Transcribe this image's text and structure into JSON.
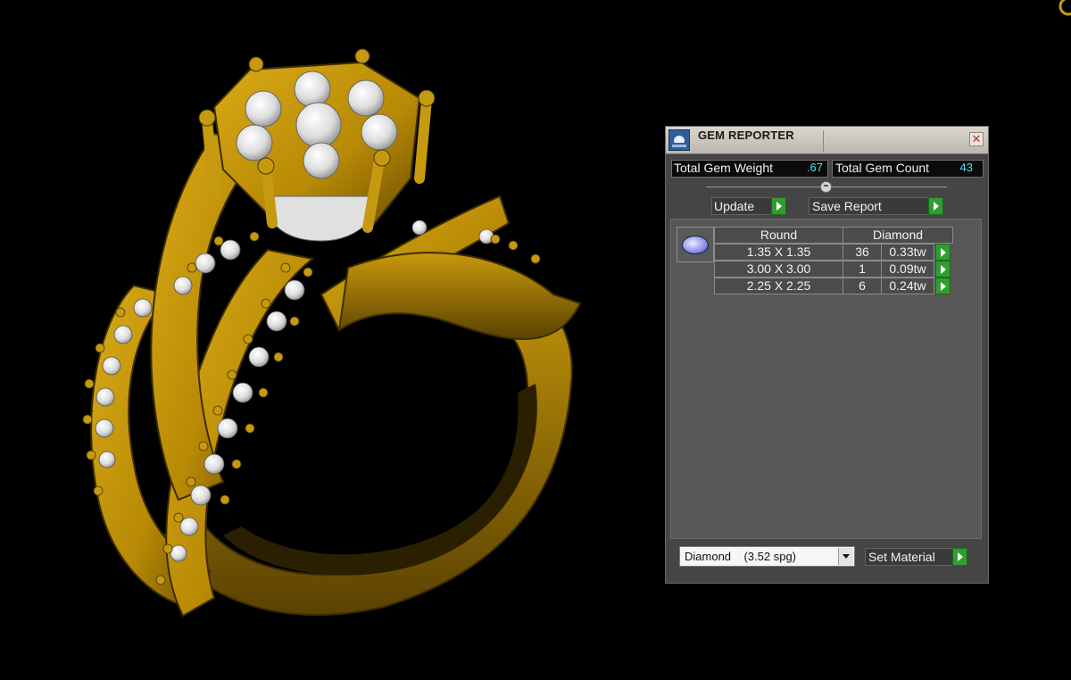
{
  "panel": {
    "title": "GEM REPORTER",
    "close_symbol": "✕",
    "total_gem_weight_label": "Total Gem Weight",
    "total_gem_weight_value": ".67",
    "total_gem_count_label": "Total Gem Count",
    "total_gem_count_value": "43",
    "update_label": "Update",
    "save_report_label": "Save Report",
    "table": {
      "shape": "Round",
      "stone": "Diamond",
      "rows": [
        {
          "size": "1.35 X 1.35",
          "count": "36",
          "weight": "0.33tw"
        },
        {
          "size": "3.00 X 3.00",
          "count": "1",
          "weight": "0.09tw"
        },
        {
          "size": "2.25 X 2.25",
          "count": "6",
          "weight": "0.24tw"
        }
      ]
    },
    "material_value": "Diamond    (3.52 spg)",
    "set_material_label": "Set Material",
    "icons": {
      "title": "gem-reporter-app-icon",
      "close": "close-icon",
      "arrow": "play-arrow-icon",
      "dropdown": "chevron-down-icon",
      "gem": "round-diamond-icon"
    }
  },
  "colors": {
    "gold": "#C79A0B",
    "background": "#000000",
    "panel": "#454545",
    "value_cyan": "#4EE0EE",
    "arrow_green": "#2F9E2F"
  }
}
